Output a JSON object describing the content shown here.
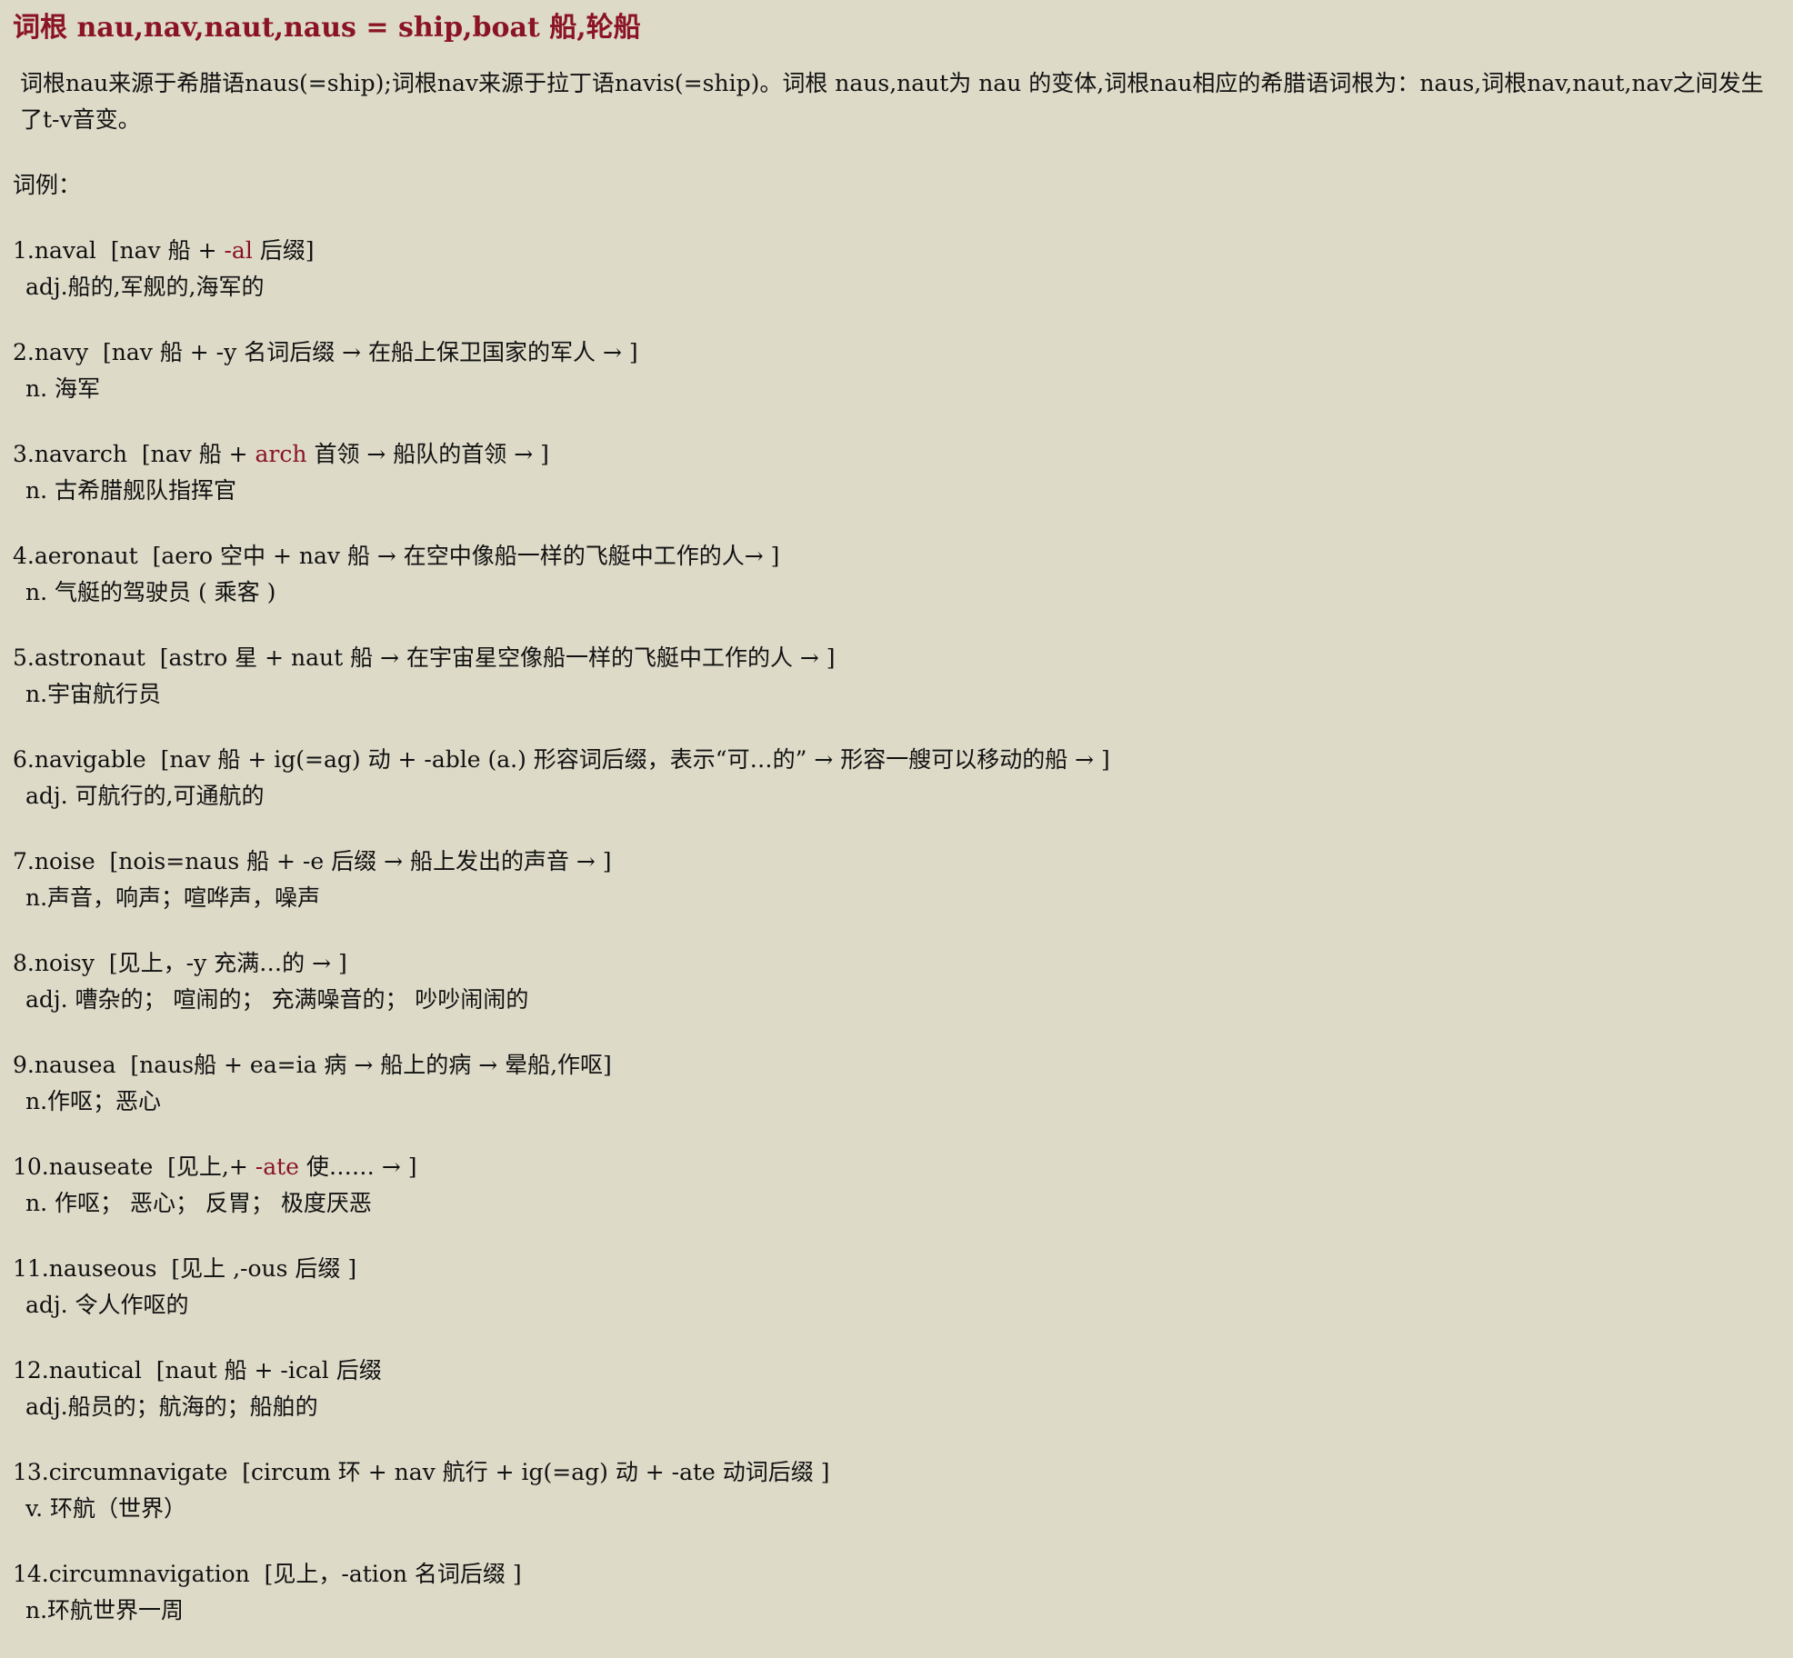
{
  "title": "词根 nau,nav,naut,naus = ship,boat 船,轮船",
  "intro": "词根nau来源于希腊语naus(=ship);词根nav来源于拉丁语navis(=ship)。词根 naus,naut为 nau 的变体,词根nau相应的希腊语词根为：naus,词根nav,naut,nav之间发生了t-v音变。",
  "examples_label": "词例：",
  "entries": [
    {
      "headword": "1.naval",
      "etym_parts": [
        "[nav 船 + ",
        "-al",
        " 后缀]"
      ],
      "meaning": "adj.船的,军舰的,海军的"
    },
    {
      "headword": "2.navy",
      "etym_parts": [
        "[nav 船 + -y 名词后缀 → 在船上保卫国家的军人 → ]"
      ],
      "meaning": "n. 海军"
    },
    {
      "headword": "3.navarch",
      "etym_parts": [
        "[nav 船 + ",
        "arch",
        " 首领 → 船队的首领 → ]"
      ],
      "meaning": "n. 古希腊舰队指挥官"
    },
    {
      "headword": "4.aeronaut",
      "etym_parts": [
        "[aero 空中 + nav 船 → 在空中像船一样的飞艇中工作的人→ ]"
      ],
      "meaning": "n. 气艇的驾驶员 ( 乘客 )"
    },
    {
      "headword": "5.astronaut",
      "etym_parts": [
        "[astro 星 + naut 船 → 在宇宙星空像船一样的飞艇中工作的人 → ]"
      ],
      "meaning": "n.宇宙航行员"
    },
    {
      "headword": "6.navigable",
      "etym_parts": [
        "[nav 船 + ig(=ag) 动 + -able (a.) 形容词后缀，表示“可…的” → 形容一艘可以移动的船 → ]"
      ],
      "meaning": "adj. 可航行的,可通航的"
    },
    {
      "headword": "7.noise",
      "etym_parts": [
        "[nois=naus 船 + -e 后缀 → 船上发出的声音 → ]"
      ],
      "meaning": "n.声音，响声；喧哗声，噪声"
    },
    {
      "headword": "8.noisy",
      "etym_parts": [
        "[见上，-y 充满…的 → ]"
      ],
      "meaning": " adj. 嘈杂的； 喧闹的； 充满噪音的； 吵吵闹闹的"
    },
    {
      "headword": "9.nausea",
      "etym_parts": [
        "[naus船 + ea=ia 病 → 船上的病 → 晕船,作呕]"
      ],
      "meaning": "n.作呕；恶心"
    },
    {
      "headword": "10.nauseate",
      "etym_parts": [
        "[见上,+ ",
        "-ate",
        " 使…… → ]"
      ],
      "meaning": "n. 作呕； 恶心； 反胃； 极度厌恶"
    },
    {
      "headword": "11.nauseous",
      "etym_parts": [
        "[见上 ,-ous 后缀 ]"
      ],
      "meaning": "adj. 令人作呕的"
    },
    {
      "headword": "12.nautical",
      "etym_parts": [
        "[naut 船 + -ical 后缀"
      ],
      "meaning": "adj.船员的；航海的；船舶的"
    },
    {
      "headword": "13.circumnavigate",
      "etym_parts": [
        "[circum 环 + nav 航行 + ig(=ag) 动 + -ate 动词后缀 ]"
      ],
      "meaning": "v. 环航（世界）"
    },
    {
      "headword": "14.circumnavigation",
      "etym_parts": [
        "[见上，-ation 名词后缀 ]"
      ],
      "meaning": "n.环航世界一周"
    }
  ],
  "colors": {
    "background": "#dddac8",
    "title": "#8b1424",
    "highlight": "#8b1424",
    "text": "#111111"
  }
}
